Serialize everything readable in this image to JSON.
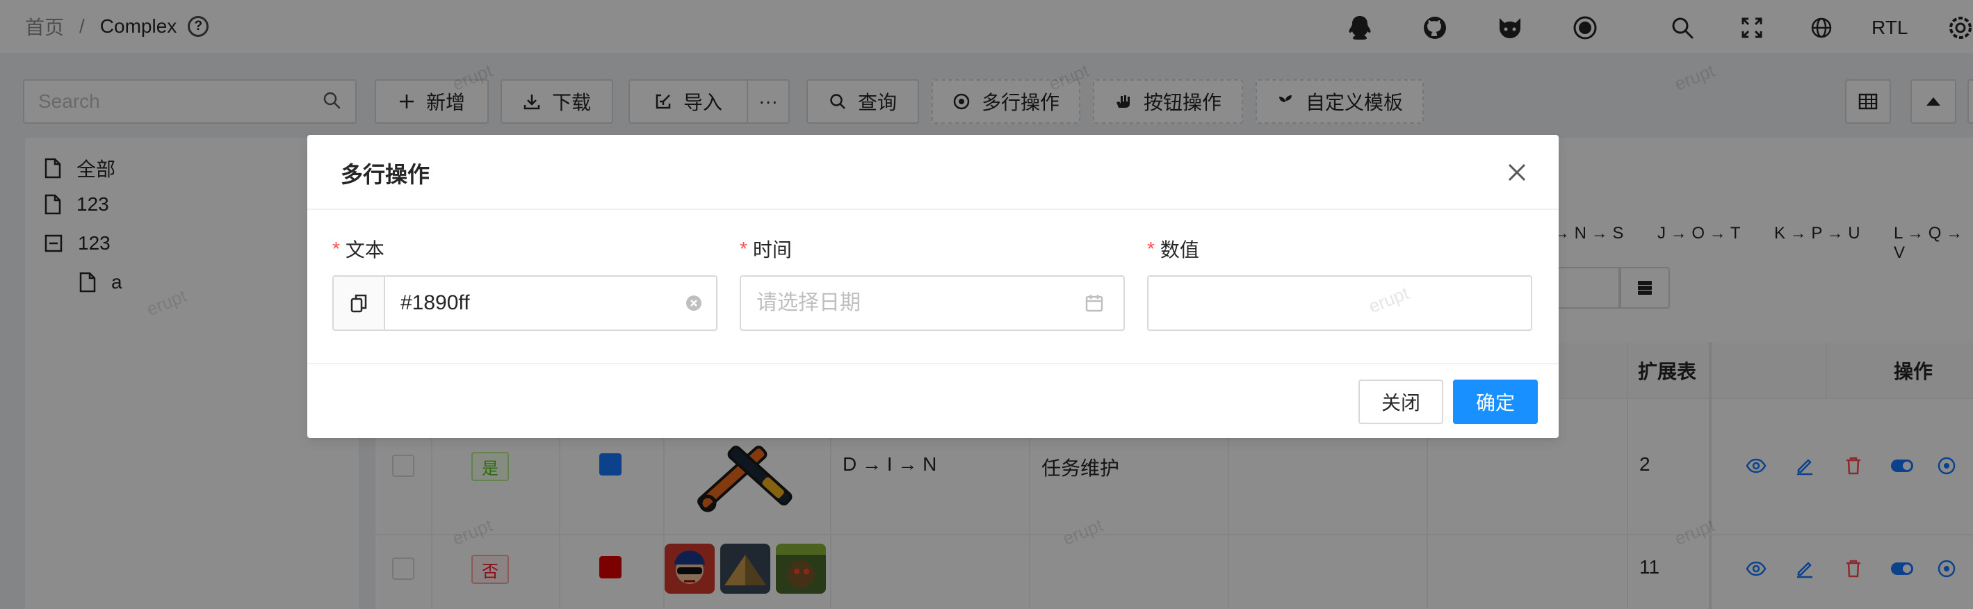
{
  "header": {
    "breadcrumb_home": "首页",
    "breadcrumb_sep": "/",
    "breadcrumb_current": "Complex",
    "help_glyph": "?",
    "rtl_label": "RTL",
    "icons": [
      "qq-icon",
      "github-icon",
      "gitee-icon",
      "record-icon",
      "search-icon",
      "fullscreen-icon",
      "globe-icon",
      "settings-icon"
    ]
  },
  "toolbar": {
    "search_placeholder": "Search",
    "add_label": "新增",
    "download_label": "下载",
    "import_label": "导入",
    "more_label": "···",
    "query_label": "查询",
    "multi_row_label": "多行操作",
    "button_op_label": "按钮操作",
    "custom_template_label": "自定义模板"
  },
  "tree": {
    "items": [
      {
        "label": "全部"
      },
      {
        "label": "123"
      },
      {
        "label": "123"
      },
      {
        "label": "a"
      }
    ]
  },
  "table": {
    "flow_tags": [
      "→ N → S",
      "J → O → T",
      "K → P → U",
      "L → Q → V"
    ],
    "headers": {
      "ext": "扩展表",
      "actions": "操作"
    },
    "rows": [
      {
        "bool_label": "是",
        "bool": true,
        "color": "#1677ff",
        "flow": "D → I → N",
        "task": "任务维护",
        "num": "2"
      },
      {
        "bool_label": "否",
        "bool": false,
        "color": "#e00000",
        "flow": "",
        "task": "",
        "num": "11"
      }
    ]
  },
  "modal": {
    "title": "多行操作",
    "required_mark": "*",
    "fields": {
      "text_label": "文本",
      "text_value": "#1890ff",
      "time_label": "时间",
      "time_placeholder": "请选择日期",
      "number_label": "数值",
      "number_value": ""
    },
    "cancel_label": "关闭",
    "ok_label": "确定"
  },
  "watermark": "erupt",
  "colors": {
    "primary": "#1890ff",
    "danger": "#ff4d4f",
    "mask": "rgba(0,0,0,0.45)"
  }
}
